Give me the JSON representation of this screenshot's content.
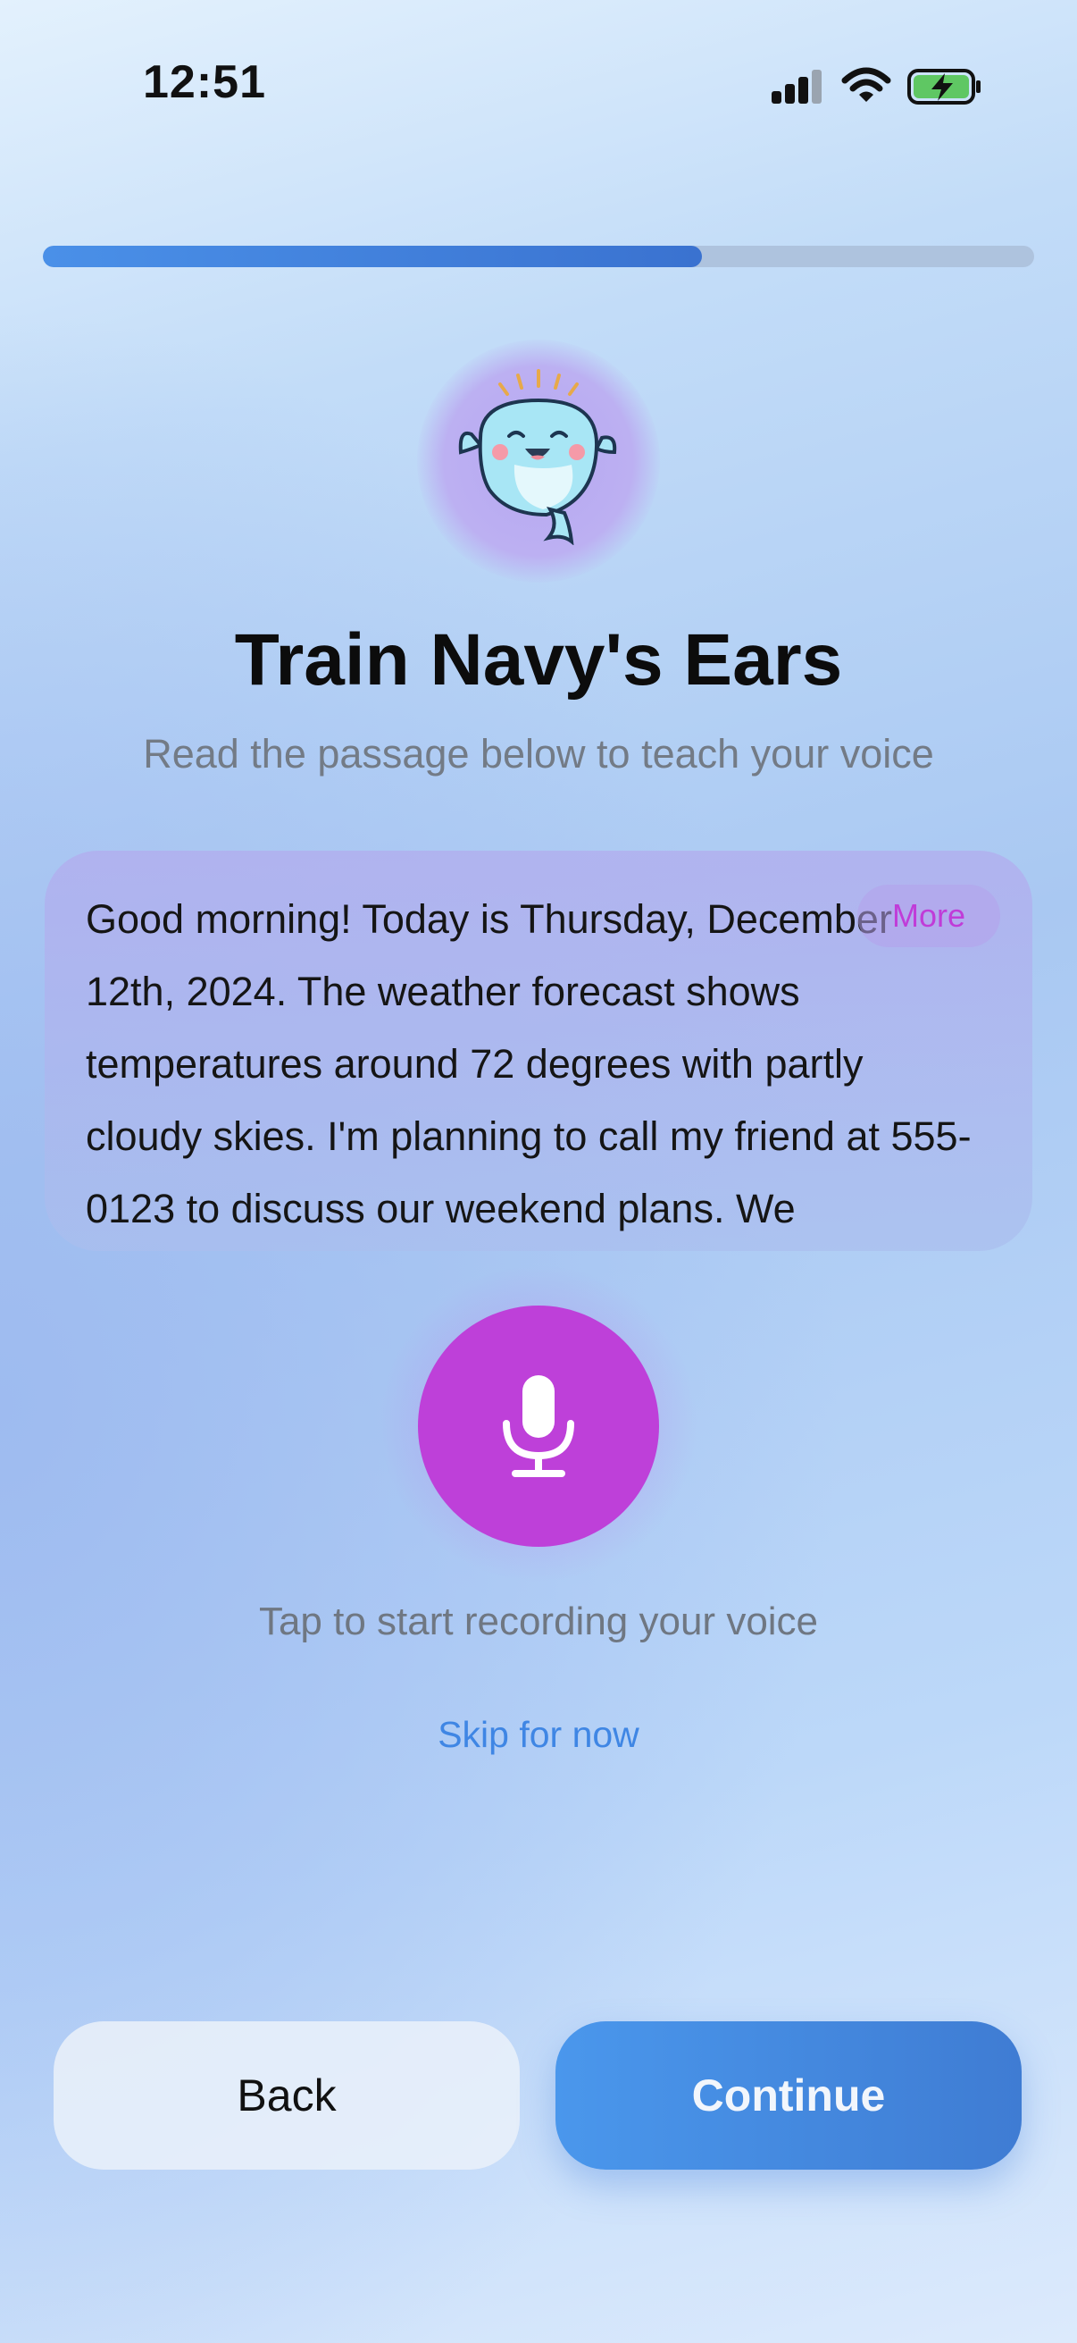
{
  "status_bar": {
    "time": "12:51"
  },
  "progress": {
    "fraction": 0.665
  },
  "header": {
    "title": "Train Navy's Ears",
    "subtitle": "Read the passage below to teach your voice"
  },
  "passage": {
    "text": "Good morning! Today is Thursday, December 12th, 2024. The weather forecast shows temperatures around 72 degrees with partly cloudy skies. I'm planning to call my friend at 555-0123 to discuss our weekend plans. We",
    "more_label": "More"
  },
  "recorder": {
    "hint": "Tap to start recording your voice",
    "skip_label": "Skip for now"
  },
  "footer": {
    "back_label": "Back",
    "continue_label": "Continue"
  },
  "icons": {
    "mascot": "dolphin-mascot",
    "mic": "microphone-icon",
    "signal": "cellular-signal-icon",
    "wifi": "wifi-icon",
    "battery": "battery-charging-icon"
  },
  "colors": {
    "accent_blue": "#3f86e4",
    "mic_purple": "#be40d9",
    "more_purple": "#c03cd8"
  }
}
